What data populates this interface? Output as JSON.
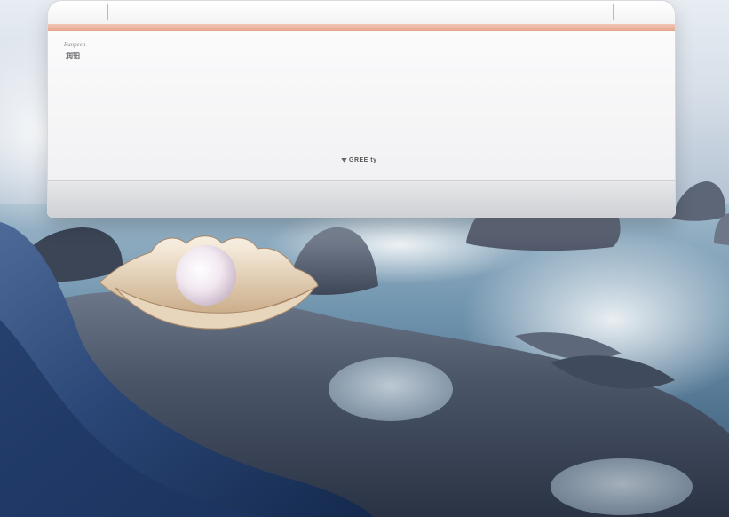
{
  "scene": {
    "description_free": true
  },
  "air_conditioner": {
    "brand_english": "Runpeen",
    "brand_chinese": "润铂",
    "logo_text": "GREE ty",
    "accent_color": "#e6a58f",
    "body_color": "#f1f1f3"
  },
  "colors": {
    "sky": "#d6dee8",
    "sea": "#4d6f8c",
    "rock": "#5a6474",
    "fabric": "#2c4a78",
    "pearl": "#f4ecf4"
  }
}
